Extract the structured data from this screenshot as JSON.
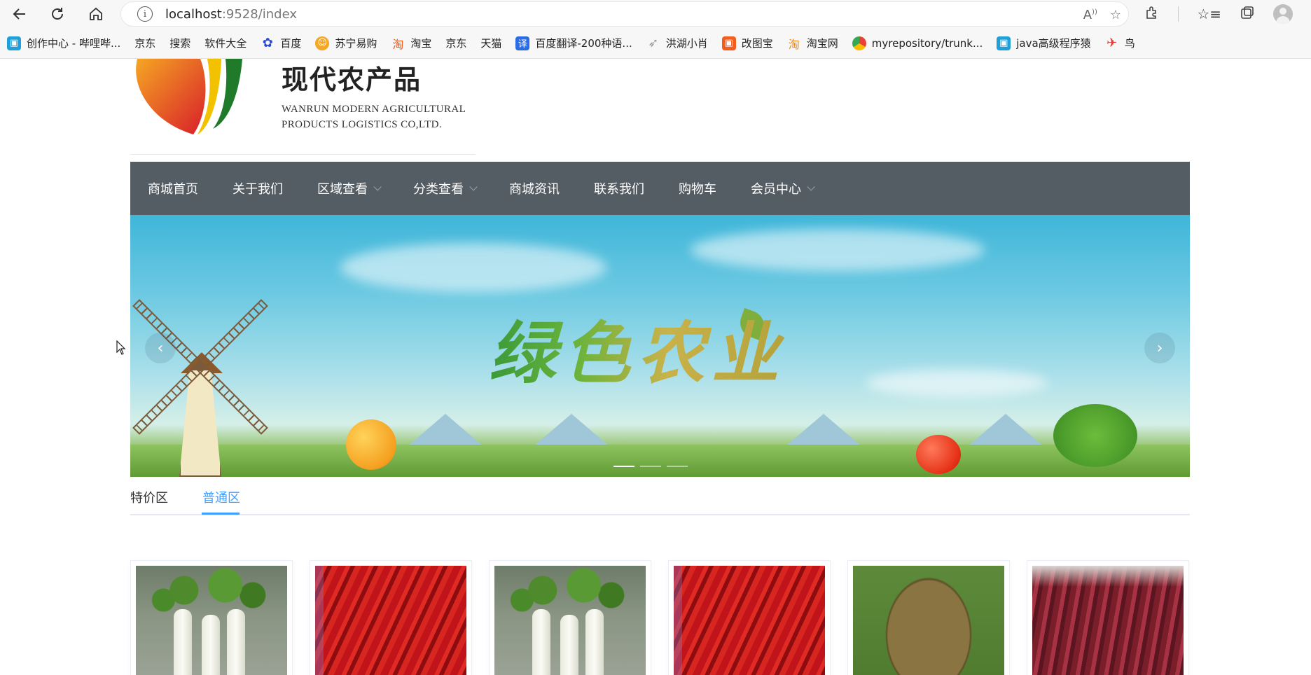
{
  "browser": {
    "url_host": "localhost",
    "url_rest": ":9528/index",
    "bookmarks": [
      {
        "label": "创作中心 - 哔哩哔...",
        "icon": "bilibili-icon"
      },
      {
        "label": "京东",
        "icon": "page-icon"
      },
      {
        "label": "搜索",
        "icon": "page-icon"
      },
      {
        "label": "软件大全",
        "icon": "page-icon"
      },
      {
        "label": "百度",
        "icon": "baidu-paw-icon"
      },
      {
        "label": "苏宁易购",
        "icon": "suning-icon"
      },
      {
        "label": "淘宝",
        "icon": "taobao-icon"
      },
      {
        "label": "京东",
        "icon": "page-icon"
      },
      {
        "label": "天猫",
        "icon": "page-icon"
      },
      {
        "label": "百度翻译-200种语...",
        "icon": "translate-icon"
      },
      {
        "label": "洪湖小肖",
        "icon": "bird-icon"
      },
      {
        "label": "改图宝",
        "icon": "gaitubao-icon"
      },
      {
        "label": "淘宝网",
        "icon": "taobao-icon"
      },
      {
        "label": "myrepository/trunk...",
        "icon": "chrome-icon"
      },
      {
        "label": "java高级程序猿",
        "icon": "bilibili-icon"
      },
      {
        "label": "鸟",
        "icon": "red-bird-icon"
      }
    ]
  },
  "logo": {
    "cn": "现代农产品",
    "en_line1": "WANRUN MODERN AGRICULTURAL",
    "en_line2": "PRODUCTS  LOGISTICS CO,LTD."
  },
  "nav": {
    "items": [
      {
        "label": "商城首页",
        "dropdown": false
      },
      {
        "label": "关于我们",
        "dropdown": false
      },
      {
        "label": "区域查看",
        "dropdown": true
      },
      {
        "label": "分类查看",
        "dropdown": true
      },
      {
        "label": "商城资讯",
        "dropdown": false
      },
      {
        "label": "联系我们",
        "dropdown": false
      },
      {
        "label": "购物车",
        "dropdown": false
      },
      {
        "label": "会员中心",
        "dropdown": true
      }
    ]
  },
  "banner": {
    "title": "绿色农业",
    "prev": "‹",
    "next": "›"
  },
  "tabs": {
    "items": [
      "特价区",
      "普通区"
    ],
    "active": "普通区"
  },
  "products": [
    {
      "image": "radish"
    },
    {
      "image": "chili"
    },
    {
      "image": "radish"
    },
    {
      "image": "chili"
    },
    {
      "image": "turtle"
    },
    {
      "image": "meat"
    }
  ],
  "colors": {
    "nav_bg": "#545c64",
    "tab_active": "#409eff"
  }
}
